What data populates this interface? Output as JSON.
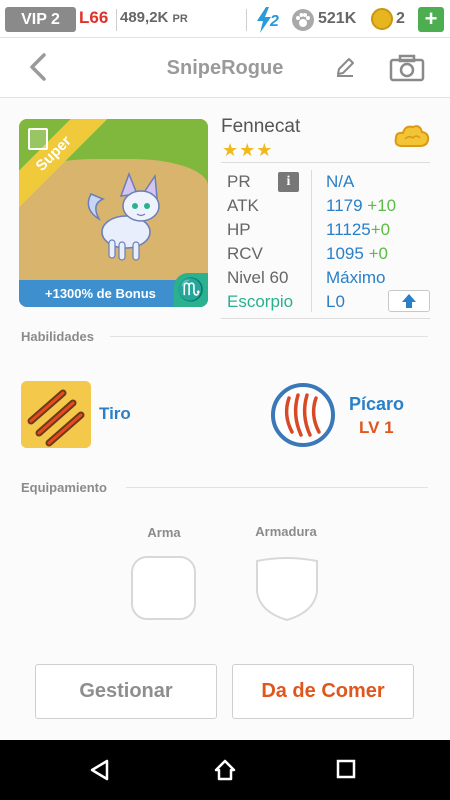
{
  "status": {
    "vip": "VIP 2",
    "level": "L66",
    "power": "489,2K",
    "power_unit": "PR",
    "energy": "2",
    "food": "521K",
    "coins": "2",
    "add": "+"
  },
  "header": {
    "back_icon": "chevron-left-icon",
    "title": "SnipeRogue",
    "edit_icon": "pencil-icon",
    "camera_icon": "camera-icon"
  },
  "monster": {
    "card_rarity": "Super",
    "bonus": "+1300% de Bonus",
    "zodiac_symbol": "♏",
    "name": "Fennecat",
    "stars": "★★★",
    "stars_count": 3,
    "stats": {
      "pr": {
        "label": "PR",
        "value": "N/A"
      },
      "atk": {
        "label": "ATK",
        "value": "1179",
        "bonus": "+10"
      },
      "hp": {
        "label": "HP",
        "value": "11125",
        "bonus": "+0"
      },
      "rcv": {
        "label": "RCV",
        "value": "1095",
        "bonus": "+0"
      },
      "level": {
        "label": "Nivel 60",
        "value": "Máximo"
      },
      "sign": {
        "label": "Escorpio",
        "value": "L0"
      }
    },
    "info_button": "i"
  },
  "skills": {
    "title": "Habilidades",
    "skill_name": "Tiro",
    "class_name": "Pícaro",
    "class_level": "LV 1"
  },
  "equipment": {
    "title": "Equipamiento",
    "weapon_label": "Arma",
    "armor_label": "Armadura"
  },
  "actions": {
    "manage": "Gestionar",
    "feed": "Da de Comer"
  },
  "colors": {
    "accent_blue": "#2a7fc7",
    "accent_orange": "#e0561d",
    "accent_green": "#5bbd45",
    "zodiac_teal": "#2bb090"
  }
}
